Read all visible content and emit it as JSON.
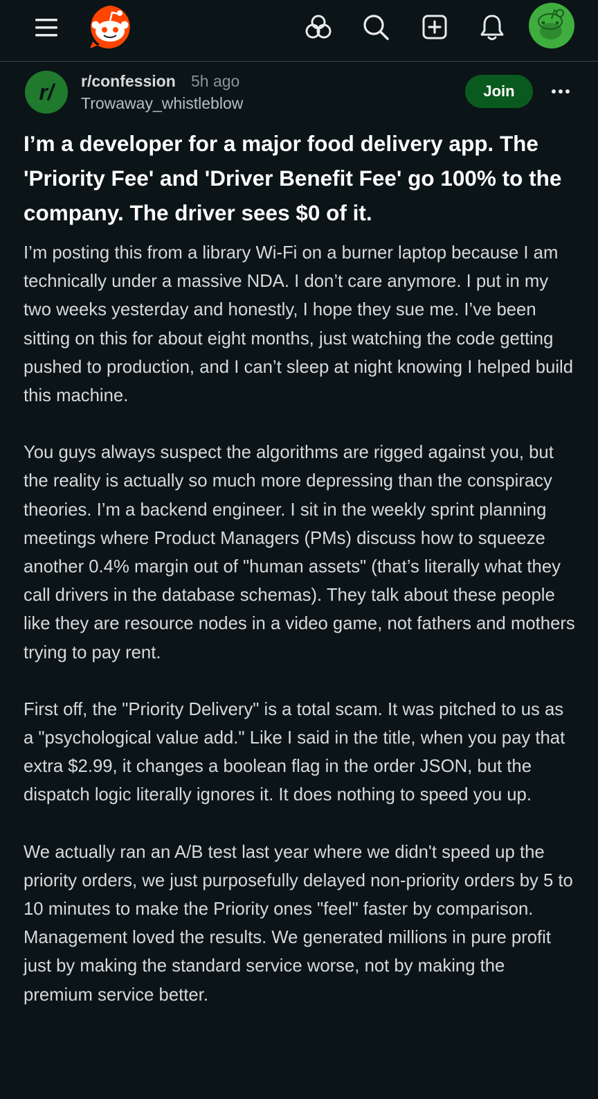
{
  "topbar": {
    "icons": [
      "menu-icon",
      "reddit-logo",
      "games-icon",
      "search-icon",
      "create-post-icon",
      "notification-bell-icon",
      "user-avatar"
    ],
    "brand_color": "#ff4500",
    "avatar_color": "#3fae3f"
  },
  "post": {
    "subreddit": "r/confession",
    "subreddit_icon_text": "r/",
    "time": "5h ago",
    "author": "Trowaway_whistleblow",
    "join_label": "Join",
    "join_color": "#0a5a1f",
    "title": "I’m a developer for a major food delivery app. The 'Priority Fee' and 'Driver Benefit Fee' go 100% to the company. The driver sees $0 of it.",
    "body": [
      "I’m posting this from a library Wi-Fi on a burner laptop because I am technically under a massive NDA. I don’t care anymore. I put in my two weeks yesterday and honestly, I hope they sue me. I’ve been sitting on this for about eight months, just watching the code getting pushed to production, and I can’t sleep at night knowing I helped build this machine.",
      "You guys always suspect the algorithms are rigged against you, but the reality is actually so much more depressing than the conspiracy theories. I’m a backend engineer. I sit in the weekly sprint planning meetings where Product Managers (PMs) discuss how to squeeze another 0.4% margin out of \"human assets\" (that’s literally what they call drivers in the database schemas). They talk about these people like they are resource nodes in a video game, not fathers and mothers trying to pay rent.",
      "First off, the \"Priority Delivery\" is a total scam. It was pitched to us as a \"psychological value add.\" Like I said in the title, when you pay that extra $2.99, it changes a boolean flag in the order JSON, but the dispatch logic literally ignores it. It does nothing to speed you up.",
      "We actually ran an A/B test last year where we didn't speed up the priority orders, we just purposefully delayed non-priority orders by 5 to 10 minutes to make the Priority ones \"feel\" faster by comparison. Management loved the results. We generated millions in pure profit just by making the standard service worse, not by making the premium service better."
    ]
  }
}
